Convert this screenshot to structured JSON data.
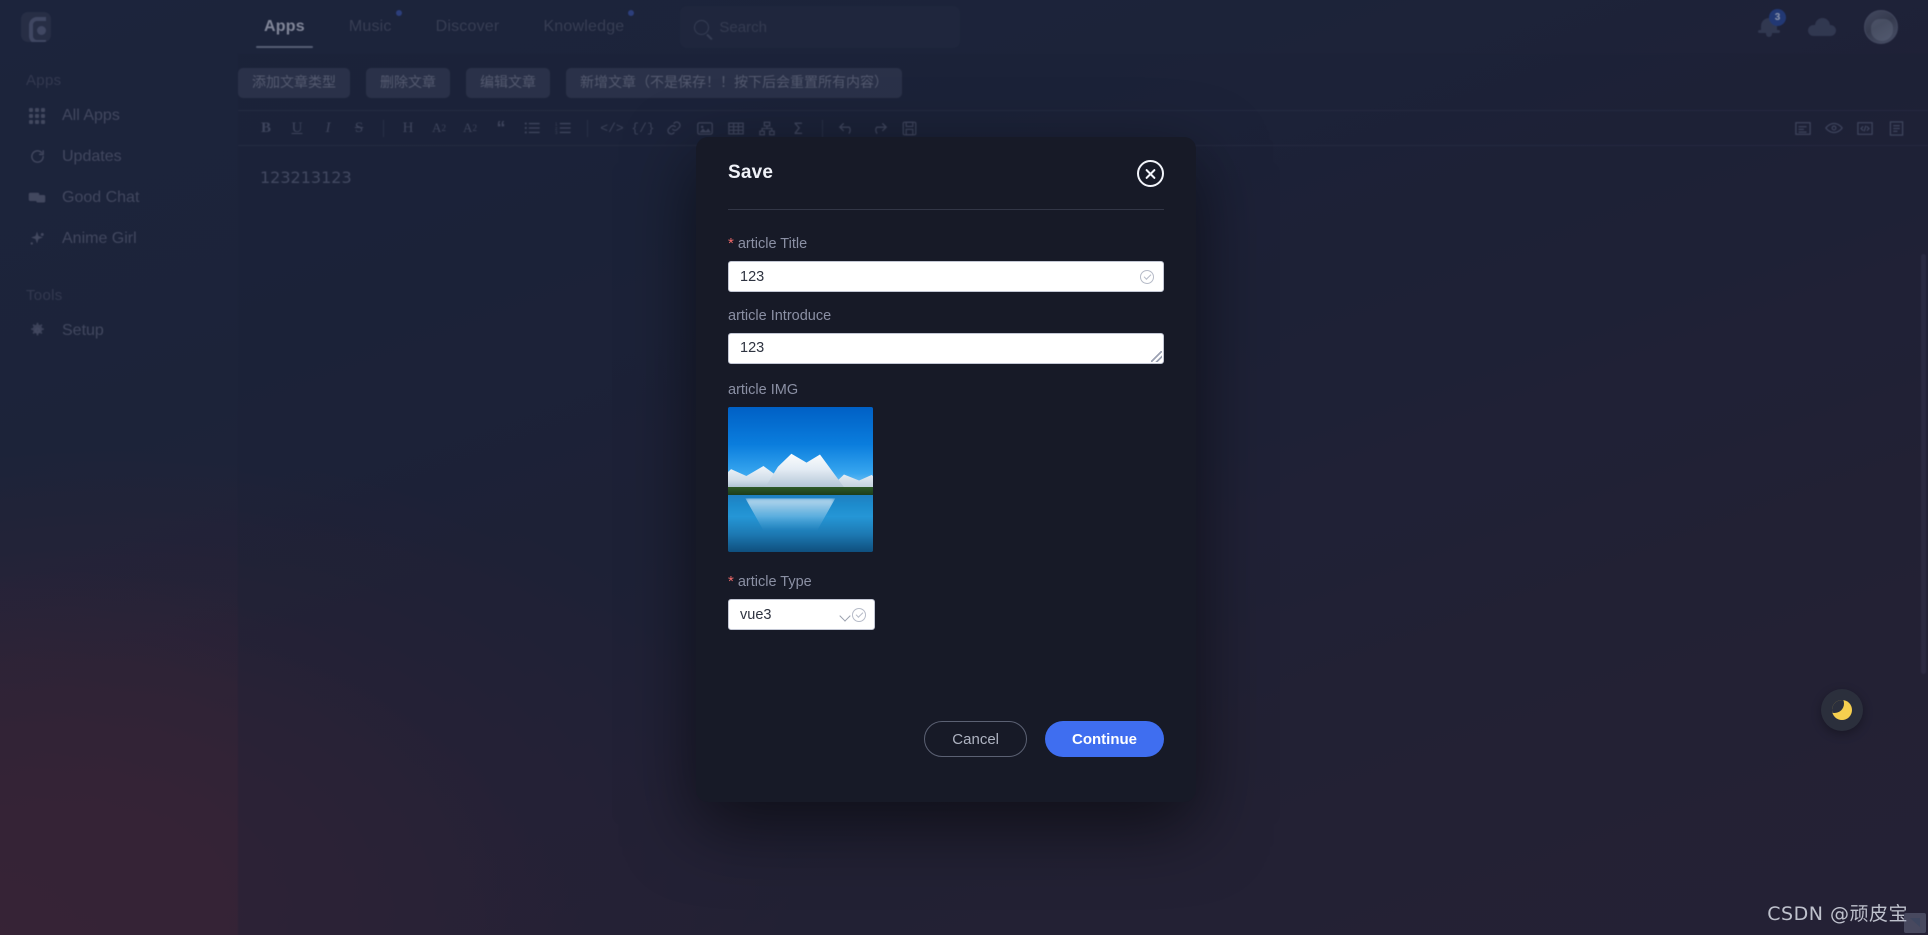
{
  "app": {
    "logo_name": "app-logo"
  },
  "topnav": {
    "tabs": [
      {
        "label": "Apps",
        "active": true,
        "dot": false
      },
      {
        "label": "Music",
        "active": false,
        "dot": true
      },
      {
        "label": "Discover",
        "active": false,
        "dot": false
      },
      {
        "label": "Knowledge",
        "active": false,
        "dot": true
      }
    ],
    "search": {
      "placeholder": "Search",
      "value": "",
      "icon": "search-icon"
    },
    "notifications": {
      "icon": "bell-icon",
      "badge": "3"
    },
    "cloud": {
      "icon": "cloud-icon"
    },
    "avatar": {
      "icon": "avatar"
    }
  },
  "sidebar": {
    "groups": [
      {
        "title": "Apps",
        "items": [
          {
            "label": "All Apps",
            "icon": "grid-icon"
          },
          {
            "label": "Updates",
            "icon": "refresh-icon"
          },
          {
            "label": "Good Chat",
            "icon": "chat-icon"
          },
          {
            "label": "Anime Girl",
            "icon": "sparkle-icon"
          }
        ]
      },
      {
        "title": "Tools",
        "items": [
          {
            "label": "Setup",
            "icon": "gear-icon"
          }
        ]
      }
    ]
  },
  "editor": {
    "action_buttons": [
      {
        "label": "添加文章类型"
      },
      {
        "label": "删除文章"
      },
      {
        "label": "编辑文章"
      },
      {
        "label": "新增文章（不是保存！！按下后会重置所有内容）"
      }
    ],
    "toolbar_icons": [
      "bold-icon",
      "underline-icon",
      "italic-icon",
      "strikethrough-icon",
      "heading-icon",
      "subscript-icon",
      "superscript-icon",
      "quote-icon",
      "bullet-list-icon",
      "numbered-list-icon",
      "inline-code-icon",
      "code-block-icon",
      "link-icon",
      "image-icon",
      "table-icon",
      "diagram-icon",
      "formula-icon",
      "undo-icon",
      "redo-icon",
      "save-icon"
    ],
    "toolbar_right_icons": [
      "align-icon",
      "preview-icon",
      "html-source-icon",
      "outline-icon"
    ],
    "content": "123213123"
  },
  "modal": {
    "title": "Save",
    "close_icon": "close-icon",
    "fields": {
      "title": {
        "label": "article Title",
        "required": true,
        "value": "123",
        "placeholder": "",
        "status_icon": "check-circle-icon"
      },
      "introduce": {
        "label": "article Introduce",
        "required": false,
        "value": "123",
        "placeholder": ""
      },
      "image": {
        "label": "article IMG",
        "alt": "mountain-lake-thumbnail"
      },
      "type": {
        "label": "article Type",
        "required": true,
        "value": "vue3",
        "options": [
          "vue3"
        ],
        "chevron_icon": "chevron-down-icon",
        "status_icon": "check-circle-icon"
      }
    },
    "buttons": {
      "cancel": "Cancel",
      "continue": "Continue"
    }
  },
  "theme_toggle": {
    "icon": "moon-icon"
  },
  "watermark": "CSDN @顽皮宝",
  "colors": {
    "accent": "#3f6ef0",
    "required": "#f06a6a",
    "modal_bg": "#171a27",
    "badge": "#2f4d9e"
  }
}
